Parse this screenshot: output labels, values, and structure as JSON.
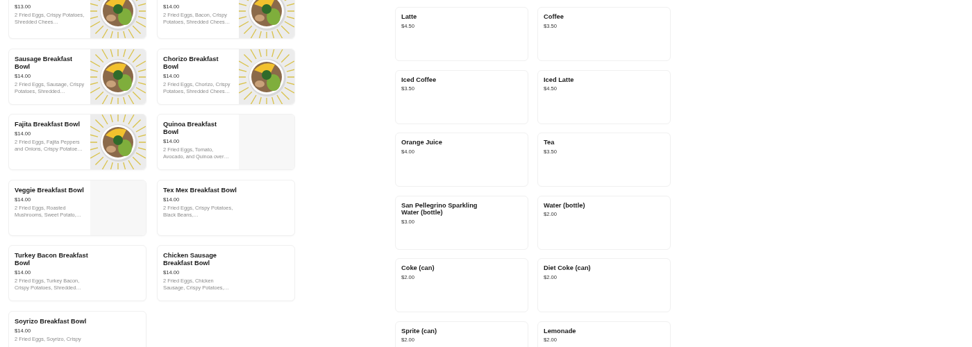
{
  "breakfast_bowls": [
    {
      "price": "$13.00",
      "description": "2 Fried Eggs, Crispy Potatoes, Shredded Chees…",
      "kind": "picture"
    },
    {
      "price": "$14.00",
      "description": "2 Fried Eggs, Bacon, Crispy Potatoes, Shredded Chees…",
      "kind": "picture"
    },
    {
      "name": "Sausage Breakfast Bowl",
      "price": "$14.00",
      "description": "2 Fried Eggs, Sausage, Crispy Potatoes, Shredded…",
      "kind": "picture"
    },
    {
      "name": "Chorizo Breakfast Bowl",
      "price": "$14.00",
      "description": "2 Fried Eggs, Chorizo, Crispy Potatoes, Shredded Chees…",
      "kind": "picture"
    },
    {
      "name": "Fajita Breakfast Bowl",
      "price": "$14.00",
      "description": "2 Fried Eggs, Fajita Peppers and Onions, Crispy Potatoe…",
      "kind": "picture"
    },
    {
      "name": "Quinoa Breakfast Bowl",
      "price": "$14.00",
      "description": "2 Fried Eggs, Tomato, Avocado, and Quinoa over…",
      "kind": "placeholder"
    },
    {
      "name": "Veggie Breakfast Bowl",
      "price": "$14.00",
      "description": "2 Fried Eggs, Roasted Mushrooms, Sweet Potato,…",
      "kind": "placeholder"
    },
    {
      "name": "Tex Mex Breakfast Bowl",
      "price": "$14.00",
      "description": "2 Fried Eggs, Crispy Potatoes, Black Beans,…"
    },
    {
      "name": "Turkey Bacon Breakfast Bowl",
      "price": "$14.00",
      "description": "2 Fried Eggs, Turkey Bacon, Crispy Potatoes, Shredded…"
    },
    {
      "name": "Chicken Sausage Breakfast Bowl",
      "price": "$14.00",
      "description": "2 Fried Eggs, Chicken Sausage, Crispy Potatoes,…"
    },
    {
      "name": "Soyrizo Breakfast Bowl",
      "price": "$14.00",
      "description": "2 Fried Eggs, Soyrizo, Crispy"
    }
  ],
  "drinks": [
    {
      "name": "Latte",
      "price": "$4.50"
    },
    {
      "name": "Coffee",
      "price": "$3.50"
    },
    {
      "name": "Iced Coffee",
      "price": "$3.50"
    },
    {
      "name": "Iced Latte",
      "price": "$4.50"
    },
    {
      "name": "Orange Juice",
      "price": "$4.00"
    },
    {
      "name": "Tea",
      "price": "$3.50"
    },
    {
      "name": "San Pellegrino Sparkling Water (bottle)",
      "price": "$3.00"
    },
    {
      "name": "Water (bottle)",
      "price": "$2.00"
    },
    {
      "name": "Coke (can)",
      "price": "$2.00"
    },
    {
      "name": "Diet Coke (can)",
      "price": "$2.00"
    },
    {
      "name": "Sprite (can)",
      "price": "$2.00"
    },
    {
      "name": "Lemonade",
      "price": "$2.00"
    }
  ]
}
